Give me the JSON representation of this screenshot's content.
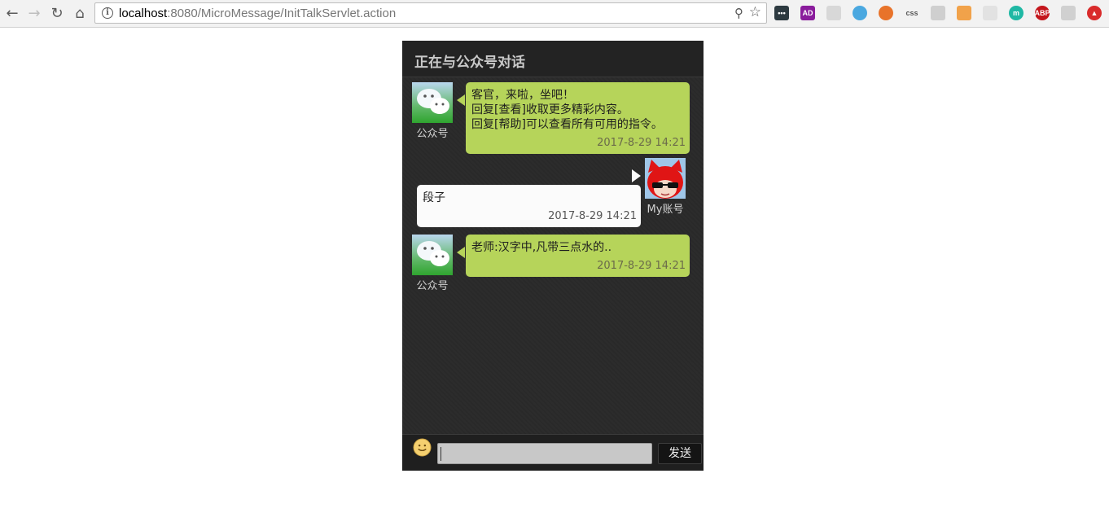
{
  "browser": {
    "url_host": "localhost",
    "url_rest": ":8080/MicroMessage/InitTalkServlet.action",
    "extensions": [
      {
        "name": "dots-extension-icon",
        "text": "•••",
        "color": "#2d3a40"
      },
      {
        "name": "ad-extension-icon",
        "text": "AD",
        "color": "#8a1c9c"
      },
      {
        "name": "circle-extension-icon",
        "text": "",
        "color": "#d8d8d8"
      },
      {
        "name": "vimium-extension-icon",
        "text": "",
        "color": "#4aa8e0"
      },
      {
        "name": "lifebuoy-extension-icon",
        "text": "",
        "color": "#e8732a"
      },
      {
        "name": "css-extension-icon",
        "text": "css",
        "color": "#f2f2f2"
      },
      {
        "name": "shield-extension-icon",
        "text": "",
        "color": "#cfcfcf"
      },
      {
        "name": "face-extension-icon",
        "text": "",
        "color": "#f1a24a"
      },
      {
        "name": "grey-extension-icon",
        "text": "",
        "color": "#e2e2e2"
      },
      {
        "name": "m-extension-icon",
        "text": "m",
        "color": "#1fb8a4"
      },
      {
        "name": "abp-extension-icon",
        "text": "ABP",
        "color": "#c4161c"
      },
      {
        "name": "tree-extension-icon",
        "text": "",
        "color": "#d0d0d0"
      },
      {
        "name": "red-extension-icon",
        "text": "▲",
        "color": "#d92b2b"
      }
    ]
  },
  "chat": {
    "title": "正在与公众号对话",
    "official_label": "公众号",
    "my_label": "My账号",
    "messages": [
      {
        "from": "official",
        "lines": [
          "客官，来啦，坐吧！",
          "回复[查看]收取更多精彩内容。",
          "回复[帮助]可以查看所有可用的指令。"
        ],
        "time": "2017-8-29 14:21"
      },
      {
        "from": "me",
        "lines": [
          "段子"
        ],
        "time": "2017-8-29 14:21"
      },
      {
        "from": "official",
        "lines": [
          "老师:汉字中,凡带三点水的.."
        ],
        "time": "2017-8-29 14:21"
      }
    ],
    "input_value": "",
    "send_label": "发送"
  }
}
